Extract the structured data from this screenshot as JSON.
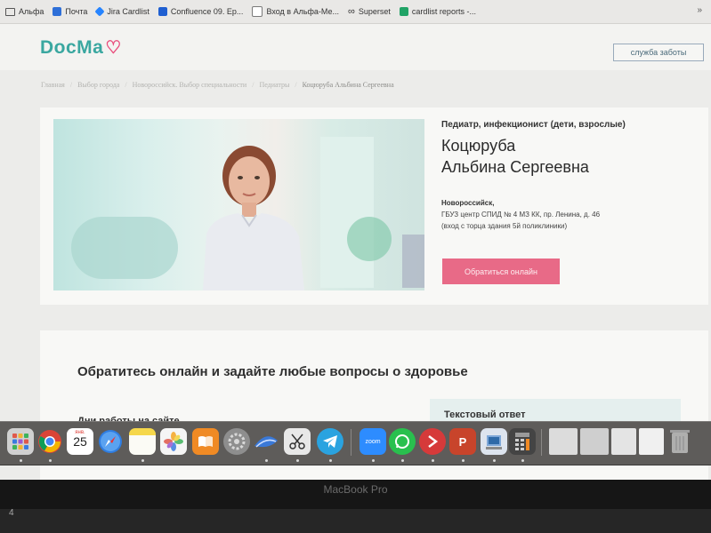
{
  "bookmarks": [
    {
      "label": "Альфа",
      "icon": "folder-icon",
      "color": "#555555"
    },
    {
      "label": "Почта",
      "icon": "mail-icon",
      "color": "#2e6fd8"
    },
    {
      "label": "Jira Cardlist",
      "icon": "jira-icon",
      "color": "#2684ff"
    },
    {
      "label": "Confluence 09. Ep...",
      "icon": "confluence-icon",
      "color": "#1f5fd1"
    },
    {
      "label": "Вход в Альфа-Ме...",
      "icon": "page-icon",
      "color": "#7a7a7a"
    },
    {
      "label": "Superset",
      "icon": "infinity-icon",
      "color": "#333333"
    },
    {
      "label": "cardlist reports -...",
      "icon": "sheets-icon",
      "color": "#21a366"
    }
  ],
  "bookmarks_more": "»",
  "site": {
    "logo": "DocMa",
    "logo_heart": "♡",
    "care_button": "служба заботы"
  },
  "breadcrumbs": [
    "Главная",
    "Выбор города",
    "Новороссийск. Выбор специальности",
    "Педиатры",
    "Коцюруба Альбина Сергеевна"
  ],
  "doctor": {
    "specialty": "Педиатр, инфекционист (дети, взрослые)",
    "surname": "Коцюруба",
    "given_names": "Альбина Сергеевна",
    "city": "Новороссийск,",
    "clinic": "ГБУЗ центр СПИД № 4 МЗ КК, пр. Ленина, д. 46",
    "note": "(вход с торца здания 5й поликлиники)",
    "contact_button": "Обратиться онлайн"
  },
  "section": {
    "title": "Обратитесь онлайн и задайте любые вопросы о здоровье",
    "days_title": "Дни работы на сайте",
    "text_answer": "Текстовый ответ"
  },
  "calendar": {
    "month": "янв.",
    "day": "25"
  },
  "dock_apps": [
    {
      "name": "launchpad-icon",
      "color": "#c9c9c9"
    },
    {
      "name": "chrome-icon",
      "color": "#e8e8e8"
    },
    {
      "name": "calendar-app-icon",
      "color": "#ffffff"
    },
    {
      "name": "safari-icon",
      "color": "#2f7de1"
    },
    {
      "name": "notes-icon",
      "color": "#f5d74a"
    },
    {
      "name": "photos-icon",
      "color": "#f0f0f0"
    },
    {
      "name": "books-icon",
      "color": "#f08a24"
    },
    {
      "name": "system-preferences-icon",
      "color": "#8e8e8e"
    },
    {
      "name": "app-blue-wave-icon",
      "color": "#3a79d8"
    },
    {
      "name": "screenshot-tool-icon",
      "color": "#e0e0e0"
    },
    {
      "name": "telegram-icon",
      "color": "#2aa3e0"
    },
    {
      "name": "zoom-icon",
      "color": "#2d8cff"
    },
    {
      "name": "whatsapp-icon",
      "color": "#29c04e"
    },
    {
      "name": "remote-desktop-icon",
      "color": "#d63a3a"
    },
    {
      "name": "powerpoint-icon",
      "color": "#c8442b"
    },
    {
      "name": "preview-icon",
      "color": "#cfd8e6"
    },
    {
      "name": "calculator-icon",
      "color": "#444444"
    },
    {
      "name": "window-thumb-1-icon",
      "color": "#dcdcdc"
    },
    {
      "name": "window-thumb-2-icon",
      "color": "#cfcfcf"
    },
    {
      "name": "window-thumb-3-icon",
      "color": "#e4e4e4"
    },
    {
      "name": "window-thumb-4-icon",
      "color": "#f0f0f0"
    },
    {
      "name": "trash-icon",
      "color": "#bdbdbd"
    }
  ],
  "dock_zoom_label": "zoom",
  "laptop_label": "MacBook Pro",
  "bezel_number": "4"
}
